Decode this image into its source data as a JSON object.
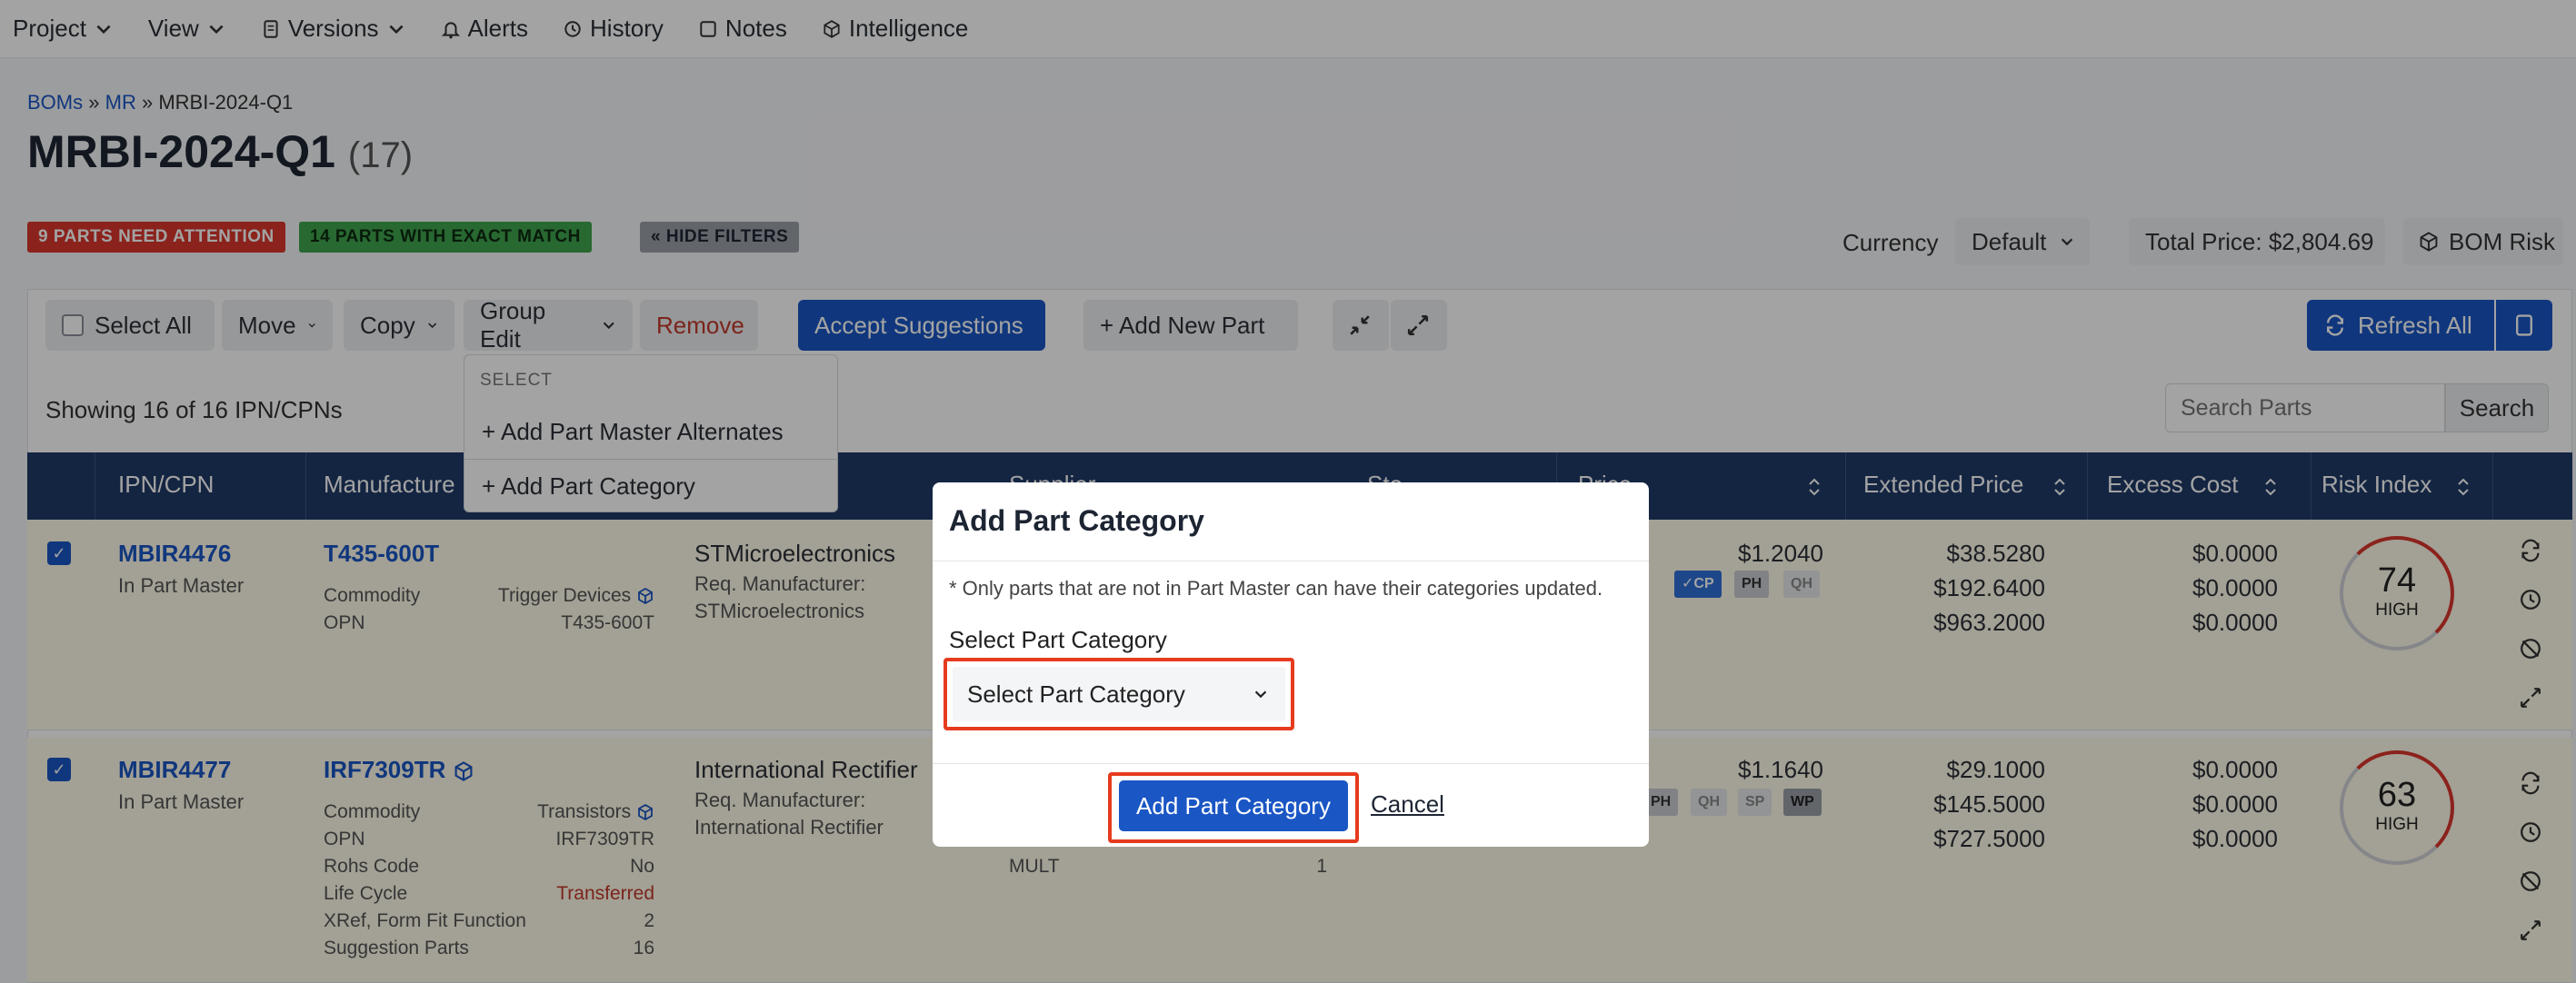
{
  "nav": {
    "items": [
      {
        "label": "Project",
        "icon": "",
        "chevron": true
      },
      {
        "label": "View",
        "icon": "",
        "chevron": true
      },
      {
        "label": "Versions",
        "icon": "document-icon",
        "chevron": true
      },
      {
        "label": "Alerts",
        "icon": "bell-icon",
        "chevron": false
      },
      {
        "label": "History",
        "icon": "history-icon",
        "chevron": false
      },
      {
        "label": "Notes",
        "icon": "note-icon",
        "chevron": false
      },
      {
        "label": "Intelligence",
        "icon": "cube-icon",
        "chevron": false
      }
    ]
  },
  "breadcrumb": {
    "boms": "BOMs",
    "mr": "MR",
    "current": "MRBI-2024-Q1",
    "sep": "»"
  },
  "page": {
    "title": "MRBI-2024-Q1",
    "count": "(17)"
  },
  "badges": {
    "attention": "9 PARTS NEED ATTENTION",
    "exact": "14 PARTS WITH EXACT MATCH",
    "hide_filters": "« HIDE FILTERS"
  },
  "header_right": {
    "currency_label": "Currency",
    "currency_value": "Default",
    "total_price": "Total Price: $2,804.69",
    "bom_risk": "BOM Risk"
  },
  "toolbar": {
    "select_all": "Select All",
    "move": "Move",
    "copy": "Copy",
    "group_edit": "Group Edit",
    "remove": "Remove",
    "accept": "Accept Suggestions",
    "add_new": "+ Add New Part",
    "refresh": "Refresh All"
  },
  "list": {
    "showing": "Showing 16 of 16 IPN/CPNs",
    "search_placeholder": "Search Parts",
    "search_button": "Search"
  },
  "dropdown": {
    "heading": "SELECT",
    "item1": "+ Add Part Master Alternates",
    "item2": "+ Add Part Category"
  },
  "table": {
    "headers": [
      "IPN/CPN",
      "Manufacture",
      "Supplier",
      "Sto",
      "Price",
      "Extended Price",
      "Excess Cost",
      "Risk Index"
    ]
  },
  "rows": [
    {
      "ipn": "MBIR4476",
      "ipn_sub": "In Part Master",
      "mpn": "T435-600T",
      "attrs": [
        [
          "Commodity",
          "Trigger Devices"
        ],
        [
          "OPN",
          "T435-600T"
        ]
      ],
      "mfr": "STMicroelectronics",
      "req_label": "Req. Manufacturer:",
      "req_value": "STMicroelectronics",
      "price": "$1.2040",
      "chips": [
        "✓CP",
        "PH",
        "QH"
      ],
      "ext": [
        "$38.5280",
        "$192.6400",
        "$963.2000"
      ],
      "excess": [
        "$0.0000",
        "$0.0000",
        "$0.0000"
      ],
      "risk": "74",
      "risk_label": "HIGH"
    },
    {
      "ipn": "MBIR4477",
      "ipn_sub": "In Part Master",
      "mpn": "IRF7309TR",
      "attrs": [
        [
          "Commodity",
          "Transistors"
        ],
        [
          "OPN",
          "IRF7309TR"
        ],
        [
          "Rohs Code",
          "No"
        ],
        [
          "Life Cycle",
          "Transferred"
        ],
        [
          "XRef, Form Fit Function",
          "2"
        ],
        [
          "Suggestion Parts",
          "16"
        ]
      ],
      "mfr": "International Rectifier",
      "req_label": "Req. Manufacturer:",
      "req_value": "International Rectifier",
      "mult_label": "MULT",
      "mult_value": "1",
      "price": "$1.1640",
      "chips": [
        "PH",
        "QH",
        "SP",
        "WP"
      ],
      "ext": [
        "$29.1000",
        "$145.5000",
        "$727.5000"
      ],
      "excess": [
        "$0.0000",
        "$0.0000",
        "$0.0000"
      ],
      "risk": "63",
      "risk_label": "HIGH"
    }
  ],
  "modal": {
    "title": "Add Part Category",
    "note": "* Only parts that are not in Part Master can have their categories updated.",
    "label": "Select Part Category",
    "select_value": "Select Part Category",
    "submit": "Add Part Category",
    "cancel": "Cancel"
  },
  "colors": {
    "primary": "#1a56c4",
    "header": "#203a68",
    "danger": "#d9362c",
    "success": "#3fa34d",
    "highlight": "#e63b1e"
  }
}
